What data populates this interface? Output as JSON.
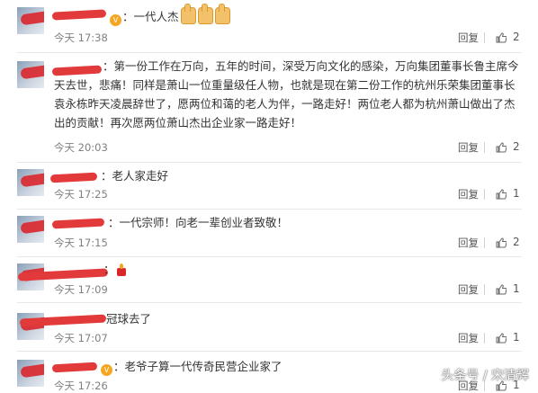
{
  "comments": [
    {
      "text": "：一代人杰",
      "time": "今天 17:38",
      "reply": "回复",
      "likes": "2"
    },
    {
      "text": "：第一份工作在万向，五年的时间，深受万向文化的感染，万向集团董事长鲁主席今天去世，悲痛！同样是萧山一位重量级任人物，也就是现在第二份工作的杭州乐荣集团董事长袁永栋昨天凌晨辞世了，愿两位和蔼的老人为伴，一路走好！两位老人都为杭州萧山做出了杰出的贡献！再次愿两位萧山杰出企业家一路走好！",
      "time": "今天 20:03",
      "reply": "回复",
      "likes": "2"
    },
    {
      "text": "：老人家走好",
      "time": "今天 17:25",
      "reply": "回复",
      "likes": "1"
    },
    {
      "text": "：一代宗师！向老一辈创业者致敬！",
      "time": "今天 17:15",
      "reply": "回复",
      "likes": "2"
    },
    {
      "text": "：",
      "time": "今天 17:09",
      "reply": "回复",
      "likes": "1"
    },
    {
      "text": "冠球去了",
      "time": "今天 17:07",
      "reply": "回复",
      "likes": "1"
    },
    {
      "text": "：老爷子算一代传奇民营企业家了",
      "time": "今天 17:26",
      "reply": "回复",
      "likes": "1"
    }
  ],
  "icons": {
    "like": "thumb-up-icon",
    "vip": "vip-badge-icon",
    "emoji_thumb": "thumbs-up-emoji-icon",
    "emoji_candle": "candle-emoji-icon"
  },
  "watermark": "头条号 / 宋清辉"
}
